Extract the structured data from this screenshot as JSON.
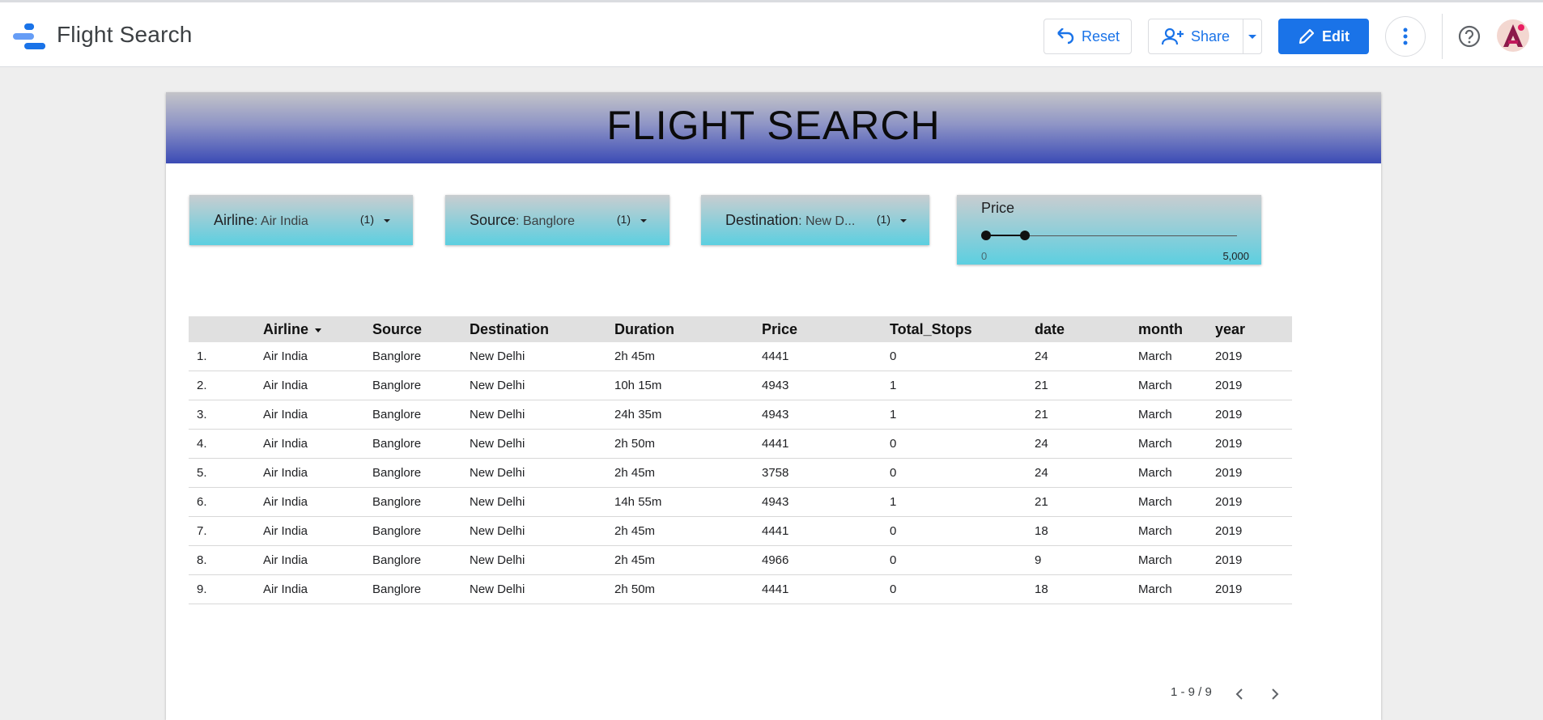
{
  "app": {
    "title": "Flight Search"
  },
  "toolbar": {
    "reset_label": "Reset",
    "share_label": "Share",
    "edit_label": "Edit",
    "accent": "#1a73e8"
  },
  "report": {
    "banner_title": "FLIGHT SEARCH",
    "filters": [
      {
        "label": "Airline",
        "value": ": Air India",
        "count": "(1)"
      },
      {
        "label": "Source",
        "value": ": Banglore",
        "count": "(1)"
      },
      {
        "label": "Destination",
        "value": ": New D...",
        "count": "(1)"
      }
    ],
    "price_slider": {
      "label": "Price",
      "min_label": "0",
      "max_label": "5,000",
      "range": [
        0,
        5000
      ],
      "selected": [
        0,
        770
      ]
    }
  },
  "table": {
    "columns": [
      "Airline",
      "Source",
      "Destination",
      "Duration",
      "Price",
      "Total_Stops",
      "date",
      "month",
      "year"
    ],
    "rows": [
      {
        "idx": "1.",
        "airline": "Air India",
        "source": "Banglore",
        "destination": "New Delhi",
        "duration": "2h 45m",
        "price": "4441",
        "stops": "0",
        "date": "24",
        "month": "March",
        "year": "2019"
      },
      {
        "idx": "2.",
        "airline": "Air India",
        "source": "Banglore",
        "destination": "New Delhi",
        "duration": "10h 15m",
        "price": "4943",
        "stops": "1",
        "date": "21",
        "month": "March",
        "year": "2019"
      },
      {
        "idx": "3.",
        "airline": "Air India",
        "source": "Banglore",
        "destination": "New Delhi",
        "duration": "24h 35m",
        "price": "4943",
        "stops": "1",
        "date": "21",
        "month": "March",
        "year": "2019"
      },
      {
        "idx": "4.",
        "airline": "Air India",
        "source": "Banglore",
        "destination": "New Delhi",
        "duration": "2h 50m",
        "price": "4441",
        "stops": "0",
        "date": "24",
        "month": "March",
        "year": "2019"
      },
      {
        "idx": "5.",
        "airline": "Air India",
        "source": "Banglore",
        "destination": "New Delhi",
        "duration": "2h 45m",
        "price": "3758",
        "stops": "0",
        "date": "24",
        "month": "March",
        "year": "2019"
      },
      {
        "idx": "6.",
        "airline": "Air India",
        "source": "Banglore",
        "destination": "New Delhi",
        "duration": "14h 55m",
        "price": "4943",
        "stops": "1",
        "date": "21",
        "month": "March",
        "year": "2019"
      },
      {
        "idx": "7.",
        "airline": "Air India",
        "source": "Banglore",
        "destination": "New Delhi",
        "duration": "2h 45m",
        "price": "4441",
        "stops": "0",
        "date": "18",
        "month": "March",
        "year": "2019"
      },
      {
        "idx": "8.",
        "airline": "Air India",
        "source": "Banglore",
        "destination": "New Delhi",
        "duration": "2h 45m",
        "price": "4966",
        "stops": "0",
        "date": "9",
        "month": "March",
        "year": "2019"
      },
      {
        "idx": "9.",
        "airline": "Air India",
        "source": "Banglore",
        "destination": "New Delhi",
        "duration": "2h 50m",
        "price": "4441",
        "stops": "0",
        "date": "18",
        "month": "March",
        "year": "2019"
      }
    ],
    "pager": "1 - 9 / 9"
  }
}
